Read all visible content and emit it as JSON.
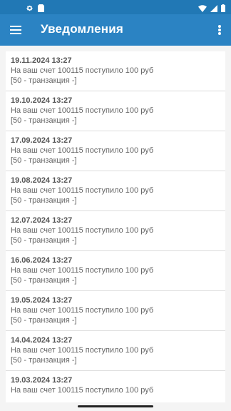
{
  "statusbar": {
    "icons": [
      "gear-icon",
      "sim-card-icon",
      "wifi-icon",
      "signal-icon",
      "battery-icon"
    ]
  },
  "appbar": {
    "title": "Уведомления",
    "menu_icon": "hamburger-menu-icon",
    "more_icon": "more-vert-icon"
  },
  "notifications": [
    {
      "date": "19.11.2024 13:27",
      "text": "На ваш счет 100115 поступило 100 руб",
      "note": "[50 - транзакция -]"
    },
    {
      "date": "19.10.2024 13:27",
      "text": "На ваш счет 100115 поступило 100 руб",
      "note": "[50 - транзакция -]"
    },
    {
      "date": "17.09.2024 13:27",
      "text": "На ваш счет 100115 поступило 100 руб",
      "note": "[50 - транзакция -]"
    },
    {
      "date": "19.08.2024 13:27",
      "text": "На ваш счет 100115 поступило 100 руб",
      "note": "[50 - транзакция -]"
    },
    {
      "date": "12.07.2024 13:27",
      "text": "На ваш счет 100115 поступило 100 руб",
      "note": "[50 - транзакция -]"
    },
    {
      "date": "16.06.2024 13:27",
      "text": "На ваш счет 100115 поступило 100 руб",
      "note": "[50 - транзакция -]"
    },
    {
      "date": "19.05.2024 13:27",
      "text": "На ваш счет 100115 поступило 100 руб",
      "note": "[50 - транзакция -]"
    },
    {
      "date": "14.04.2024 13:27",
      "text": "На ваш счет 100115 поступило 100 руб",
      "note": "[50 - транзакция -]"
    },
    {
      "date": "19.03.2024 13:27",
      "text": "На ваш счет 100115 поступило 100 руб",
      "note": ""
    }
  ],
  "colors": {
    "statusbar": "#2178b5",
    "appbar": "#2b83c3",
    "background": "#f4f4f4"
  }
}
